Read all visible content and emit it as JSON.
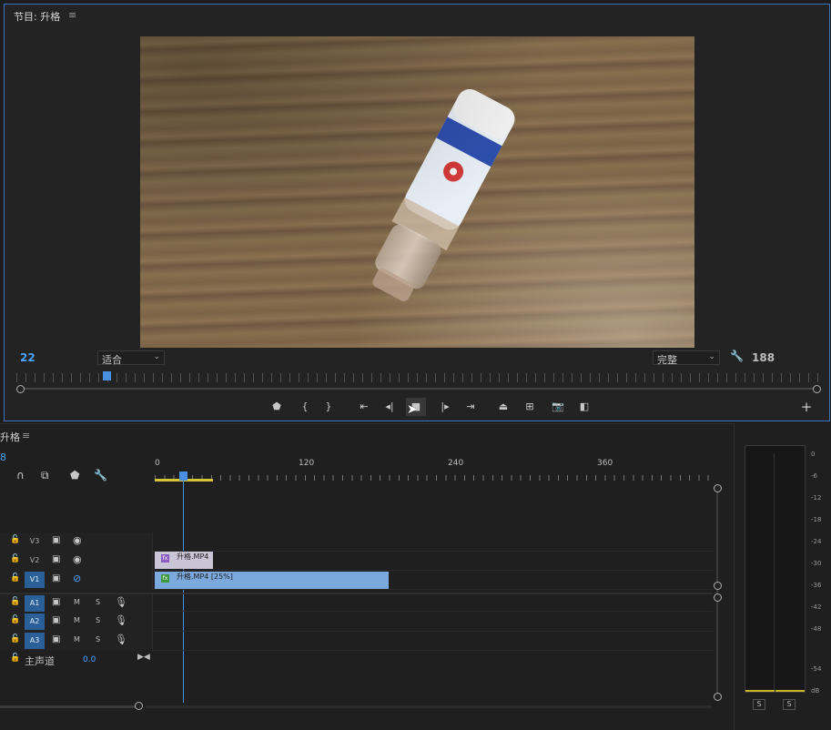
{
  "program_monitor": {
    "title": "节目: 升格",
    "menu_icon": "≡",
    "frame_left": "22",
    "fit_value": "适合",
    "full_value": "完整",
    "frame_right": "188"
  },
  "timeline": {
    "title": "升格",
    "menu_icon": "≡",
    "timecode": "8",
    "ruler_labels": [
      "0",
      "120",
      "240",
      "360"
    ],
    "tracks": [
      {
        "name": "V3",
        "type": "video",
        "selected": false
      },
      {
        "name": "V2",
        "type": "video",
        "selected": false
      },
      {
        "name": "V1",
        "type": "video",
        "selected": true
      },
      {
        "name": "A1",
        "type": "audio",
        "selected": true
      },
      {
        "name": "A2",
        "type": "audio",
        "selected": true
      },
      {
        "name": "A3",
        "type": "audio",
        "selected": true
      }
    ],
    "mute_label": "M",
    "solo_label": "S",
    "clips": [
      {
        "track": "V2",
        "label": "升格.MP4"
      },
      {
        "track": "V1",
        "label": "升格.MP4 [25%]"
      }
    ],
    "master": {
      "label": "主声道",
      "value": "0.0"
    }
  },
  "meters": {
    "db_labels": [
      "0",
      "-6",
      "-12",
      "-18",
      "-24",
      "-30",
      "-36",
      "-42",
      "-48",
      "-54",
      "dB"
    ],
    "solo_left": "S",
    "solo_right": "S"
  },
  "colors": {
    "accent": "#4aa3ff",
    "selected_track": "#2a5f97",
    "clip_v1": "#7ba9de",
    "clip_v2": "#c9c5d6",
    "work_area": "#d6c33a",
    "panel_border": "#3d73b8"
  }
}
